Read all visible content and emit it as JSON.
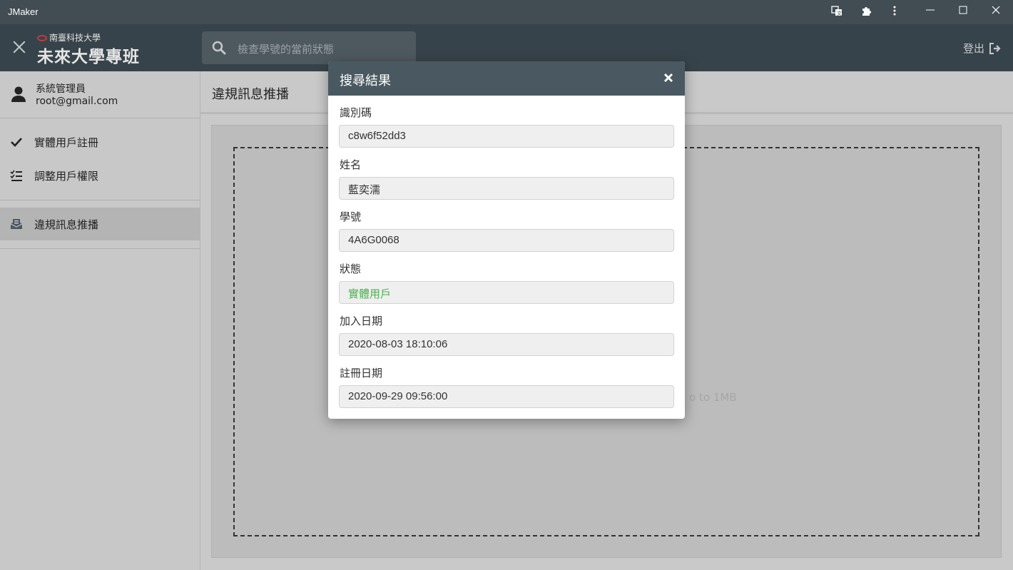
{
  "window": {
    "title": "JMaker"
  },
  "header": {
    "logo_top": "南臺科技大學",
    "logo_main": "未來大學專班",
    "search_placeholder": "檢查學號的當前狀態",
    "logout_label": "登出"
  },
  "sidebar": {
    "user_name": "系統管理員",
    "user_email": "root@gmail.com",
    "items": [
      {
        "label": "實體用戶註冊",
        "icon": "check-icon"
      },
      {
        "label": "調整用戶權限",
        "icon": "checklist-icon"
      },
      {
        "label": "違規訊息推播",
        "icon": "mailbox-icon",
        "active": true
      }
    ]
  },
  "main": {
    "page_title": "違規訊息推播",
    "dropzone_hint": "o to 1MB"
  },
  "modal": {
    "title": "搜尋結果",
    "fields": [
      {
        "label": "識別碼",
        "value": "c8w6f52dd3"
      },
      {
        "label": "姓名",
        "value": "藍奕濡"
      },
      {
        "label": "學號",
        "value": "4A6G0068"
      },
      {
        "label": "狀態",
        "value": "實體用戶"
      },
      {
        "label": "加入日期",
        "value": "2020-08-03 18:10:06"
      },
      {
        "label": "註冊日期",
        "value": "2020-09-29 09:56:00"
      }
    ]
  },
  "colors": {
    "titlebar": "#414c53",
    "appbar": "#37434a",
    "modal_header": "#4a5961",
    "status_value": "#4caf50"
  }
}
